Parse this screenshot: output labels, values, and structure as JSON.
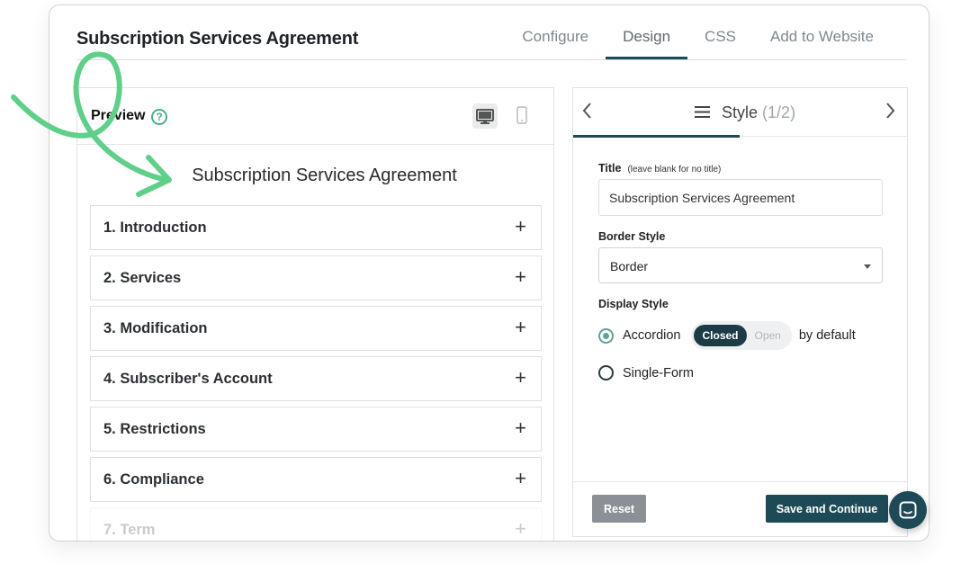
{
  "app": {
    "title": "Subscription Services Agreement"
  },
  "tabs": [
    {
      "label": "Configure",
      "active": false
    },
    {
      "label": "Design",
      "active": true
    },
    {
      "label": "CSS",
      "active": false
    },
    {
      "label": "Add to Website",
      "active": false
    }
  ],
  "preview": {
    "label": "Preview",
    "agreement_title": "Subscription Services Agreement",
    "sections": [
      "1. Introduction",
      "2. Services",
      "3. Modification",
      "4. Subscriber's Account",
      "5. Restrictions",
      "6. Compliance",
      "7. Term"
    ]
  },
  "style_panel": {
    "heading": "Style",
    "page_indicator": "(1/2)",
    "title_label": "Title",
    "title_hint": "(leave blank for no title)",
    "title_value": "Subscription Services Agreement",
    "border_label": "Border Style",
    "border_value": "Border",
    "display_label": "Display Style",
    "accordion_label": "Accordion",
    "toggle_closed": "Closed",
    "toggle_open": "Open",
    "by_default": "by default",
    "single_form_label": "Single-Form",
    "reset_label": "Reset",
    "save_label": "Save and Continue"
  },
  "colors": {
    "accent": "#1e4a58",
    "annotation": "#5fcf8a",
    "radio_checked": "#5fa39a"
  },
  "icons": [
    "help-icon",
    "desktop-icon",
    "mobile-icon",
    "menu-icon",
    "chevron-left-icon",
    "chevron-right-icon",
    "plus-icon",
    "caret-down-icon",
    "chat-icon"
  ]
}
